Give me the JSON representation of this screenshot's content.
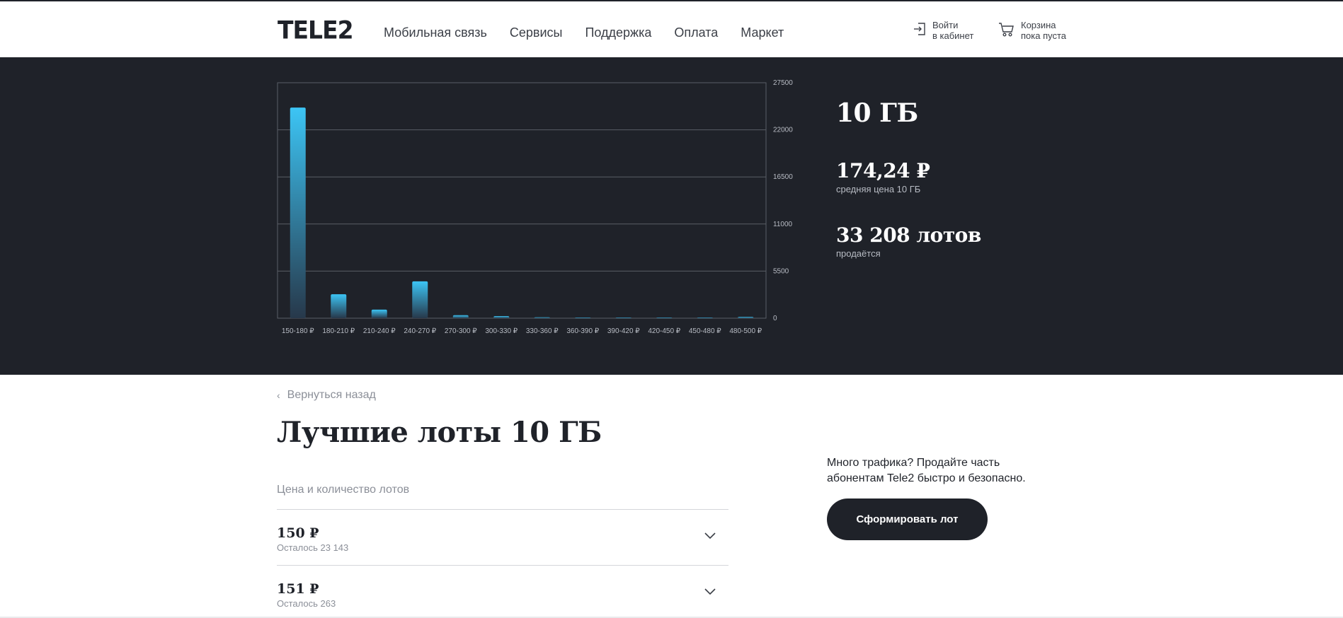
{
  "header": {
    "logo": "TELE2",
    "nav": [
      "Мобильная связь",
      "Сервисы",
      "Поддержка",
      "Оплата",
      "Маркет"
    ],
    "login_line1": "Войти",
    "login_line2": "в кабинет",
    "cart_line1": "Корзина",
    "cart_line2": "пока пуста"
  },
  "chart_data": {
    "type": "bar",
    "categories": [
      "150-180 ₽",
      "180-210 ₽",
      "210-240 ₽",
      "240-270 ₽",
      "270-300 ₽",
      "300-330 ₽",
      "330-360 ₽",
      "360-390 ₽",
      "390-420 ₽",
      "420-450 ₽",
      "450-480 ₽",
      "480-500 ₽"
    ],
    "values": [
      24600,
      2800,
      1000,
      4300,
      350,
      250,
      100,
      40,
      60,
      40,
      30,
      150
    ],
    "ylim": [
      0,
      27500
    ],
    "yticks": [
      0,
      5500,
      11000,
      16500,
      22000,
      27500
    ],
    "yaxis_side": "right",
    "grid": true,
    "bar_color_top": "#3cc5f5",
    "bar_color_bottom": "#27384a"
  },
  "stats": {
    "volume": "10 ГБ",
    "avg_price": "174,24 ₽",
    "avg_price_label": "средняя цена 10 ГБ",
    "lots_count": "33 208 лотов",
    "lots_label": "продаётся"
  },
  "back_link": "Вернуться назад",
  "page_title": "Лучшие лоты 10 ГБ",
  "list_header": "Цена и количество лотов",
  "lots": [
    {
      "price": "150 ₽",
      "remaining": "Осталось 23 143"
    },
    {
      "price": "151 ₽",
      "remaining": "Осталось 263"
    }
  ],
  "promo_text": "Много трафика? Продайте часть абонентам Tele2 быстро и безопасно.",
  "cta_label": "Сформировать лот"
}
